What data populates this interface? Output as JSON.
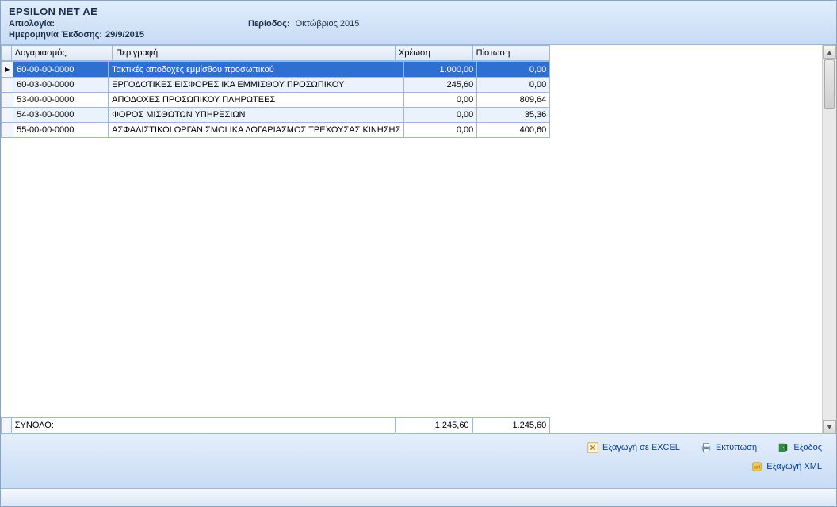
{
  "header": {
    "company": "EPSILON NET AE",
    "reason_label": "Αιτιολογία:",
    "reason_value": "",
    "period_label": "Περίοδος:",
    "period_value": "Οκτώβριος 2015",
    "issue_date_label": "Ημερομηνία Έκδοσης:",
    "issue_date_value": "29/9/2015"
  },
  "grid": {
    "columns": {
      "account": "Λογαριασμός",
      "description": "Περιγραφή",
      "debit": "Χρέωση",
      "credit": "Πίστωση"
    },
    "rows": [
      {
        "account": "60-00-00-0000",
        "description": "Τακτικές αποδοχές εμμίσθου προσωπικού",
        "debit": "1.000,00",
        "credit": "0,00",
        "selected": true
      },
      {
        "account": "60-03-00-0000",
        "description": "ΕΡΓΟΔΟΤΙΚΕΣ ΕΙΣΦΟΡΕΣ ΙΚΑ ΕΜΜΙΣΘΟΥ ΠΡΟΣΩΠΙΚΟΥ",
        "debit": "245,60",
        "credit": "0,00"
      },
      {
        "account": "53-00-00-0000",
        "description": "ΑΠΟΔΟΧΕΣ ΠΡΟΣΩΠΙΚΟΥ ΠΛΗΡΩΤΕΕΣ",
        "debit": "0,00",
        "credit": "809,64"
      },
      {
        "account": "54-03-00-0000",
        "description": "ΦΟΡΟΣ ΜΙΣΘΩΤΩΝ ΥΠΗΡΕΣΙΩΝ",
        "debit": "0,00",
        "credit": "35,36"
      },
      {
        "account": "55-00-00-0000",
        "description": "ΑΣΦΑΛΙΣΤΙΚΟΙ ΟΡΓΑΝΙΣΜΟΙ ΙΚΑ ΛΟΓΑΡΙΑΣΜΟΣ ΤΡΕΧΟΥΣΑΣ ΚΙΝΗΣΗΣ",
        "debit": "0,00",
        "credit": "400,60"
      }
    ],
    "footer": {
      "label": "ΣΥΝΟΛΟ:",
      "debit_total": "1.245,60",
      "credit_total": "1.245,60"
    }
  },
  "footer": {
    "export_excel": "Εξαγωγή σε EXCEL",
    "print": "Εκτύπωση",
    "exit": "Έξοδος",
    "export_xml": "Εξαγωγή XML"
  }
}
